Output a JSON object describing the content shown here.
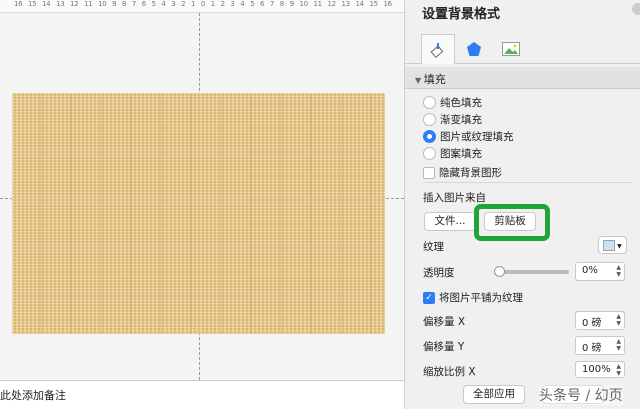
{
  "ruler": {
    "ticks": [
      "16",
      "15",
      "14",
      "13",
      "12",
      "11",
      "10",
      "9",
      "8",
      "7",
      "6",
      "5",
      "4",
      "3",
      "2",
      "1",
      "0",
      "1",
      "2",
      "3",
      "4",
      "5",
      "6",
      "7",
      "8",
      "9",
      "10",
      "11",
      "12",
      "13",
      "14",
      "15",
      "16"
    ]
  },
  "notes": {
    "placeholder": "此处添加备注"
  },
  "panel": {
    "title": "设置背景格式",
    "tabs": [
      {
        "icon": "paint-bucket-icon"
      },
      {
        "icon": "pentagon-icon"
      },
      {
        "icon": "picture-icon"
      }
    ],
    "section": "填充",
    "fill_options": [
      "纯色填充",
      "渐变填充",
      "图片或纹理填充",
      "图案填充"
    ],
    "selected_fill": "图片或纹理填充",
    "hide_bg": "隐藏背景图形",
    "insert_from": "插入图片来自",
    "file_btn": "文件...",
    "clipboard_btn": "剪贴板",
    "texture": "纹理",
    "transparency": "透明度",
    "transparency_value": "0%",
    "transparency_fraction": 0,
    "tile": "将图片平铺为纹理",
    "offset_x": "偏移量 X",
    "offset_x_value": "0 磅",
    "offset_y": "偏移量 Y",
    "offset_y_value": "0 磅",
    "scale_x": "缩放比例 X",
    "scale_x_value": "100%",
    "apply_all": "全部应用",
    "watermark": "头条号 / 幻页"
  },
  "colors": {
    "highlight": "#1fa43a",
    "accent": "#2d7ef5"
  }
}
